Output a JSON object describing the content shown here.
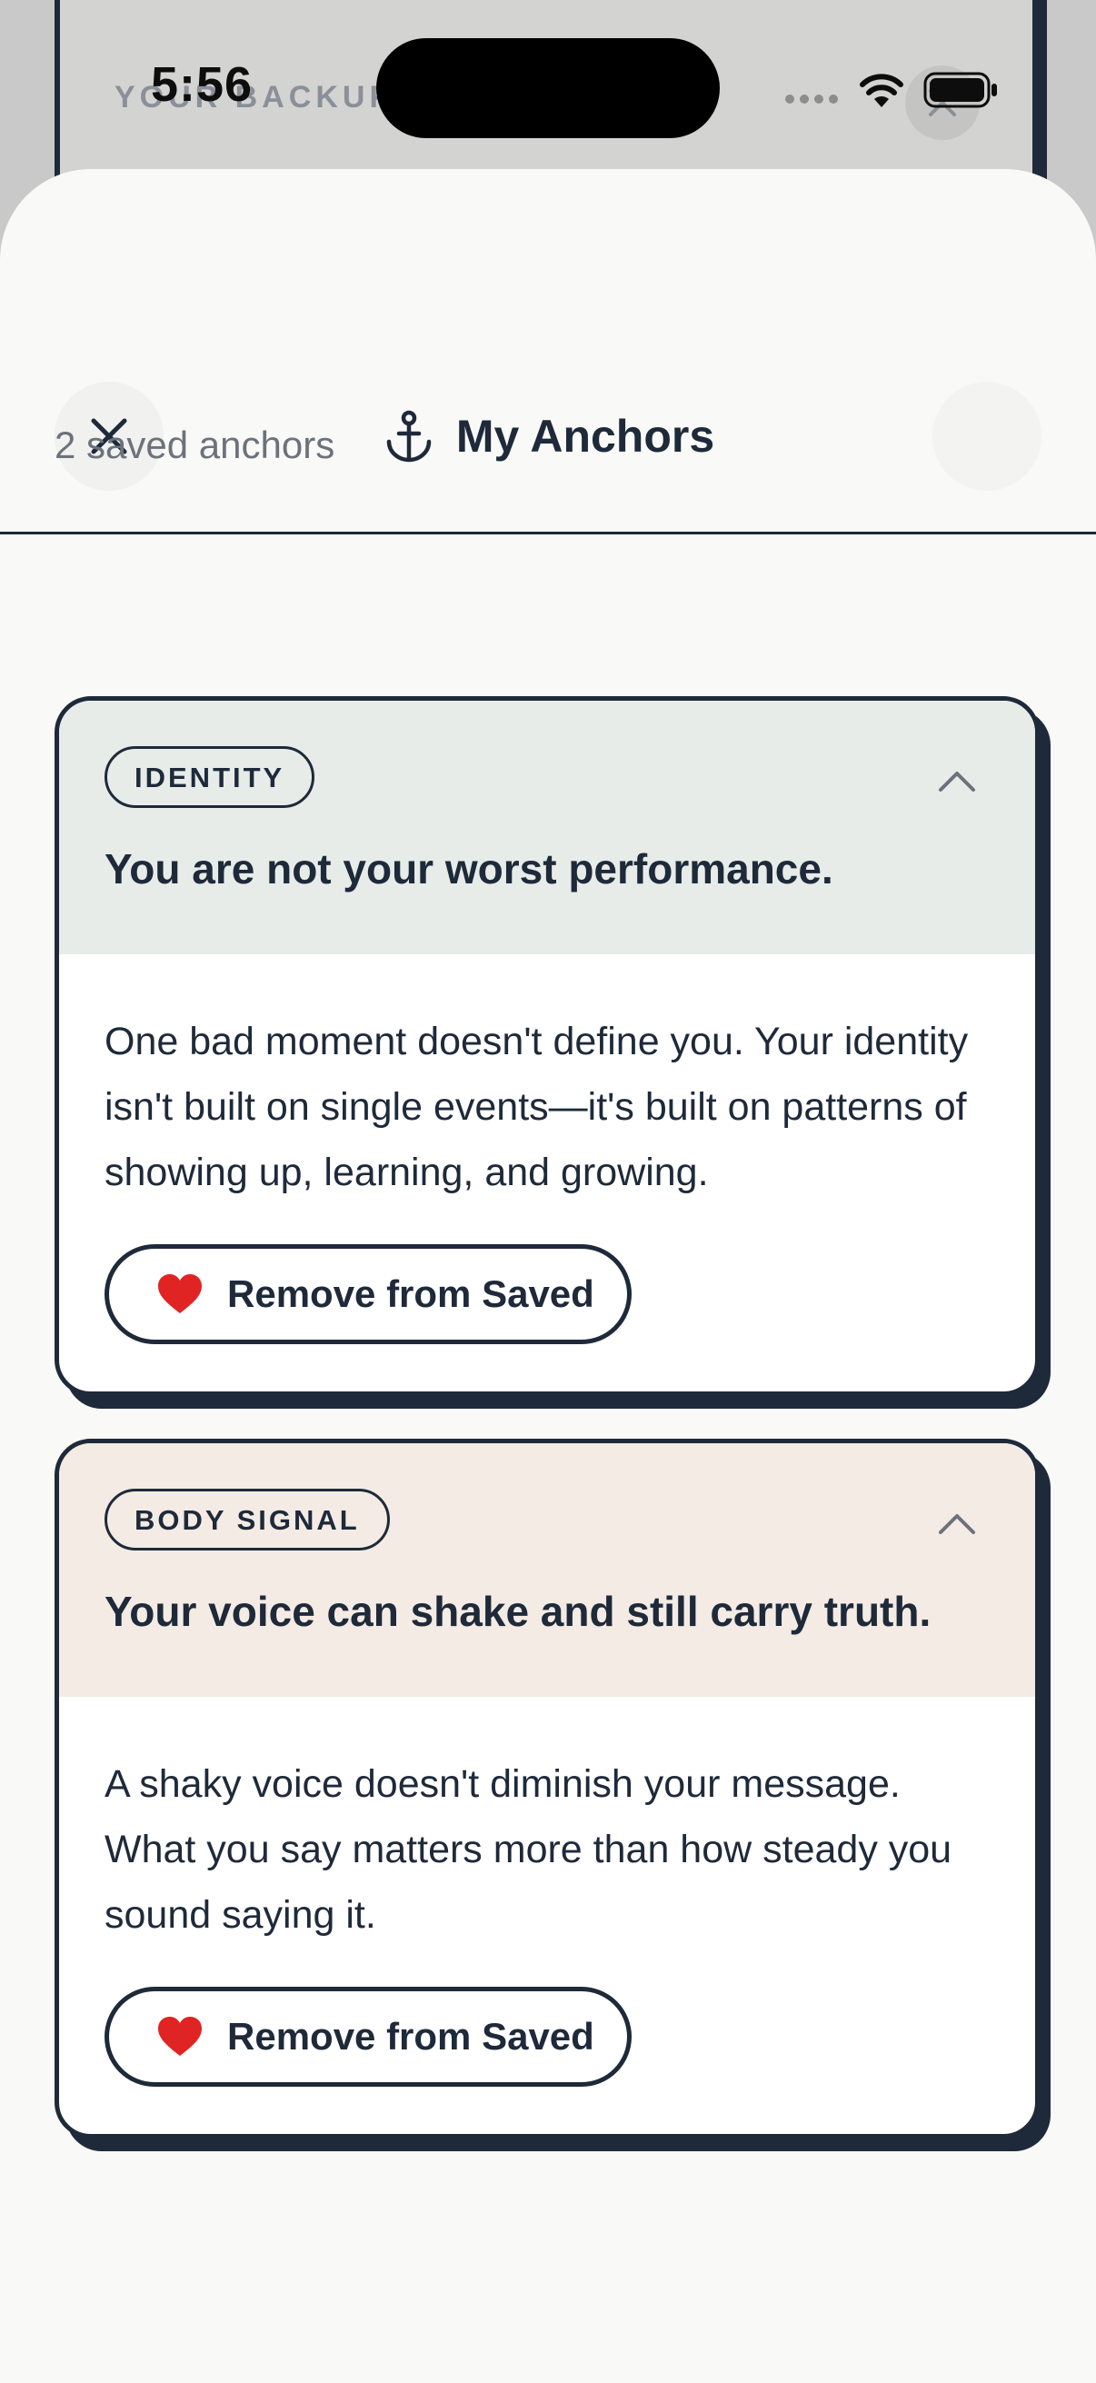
{
  "status_bar": {
    "time": "5:56"
  },
  "background_sheet": {
    "title": "YOUR BACKUP"
  },
  "header": {
    "title": "My Anchors",
    "title_icon": "anchor-icon",
    "close_icon": "close-icon"
  },
  "summary": {
    "count_text": "2 saved anchors"
  },
  "colors": {
    "ink": "#1e2a3a",
    "sheet_bg": "#f9f9f7",
    "identity_header_bg": "#e7ece9",
    "body_signal_header_bg": "#f4ebe4",
    "heart": "#e02424",
    "muted_text": "#6b727c"
  },
  "anchors": [
    {
      "tag": "IDENTITY",
      "title": "You are not your worst performance.",
      "body": "One bad moment doesn't define you. Your identity isn't built on single events—it's built on patterns of showing up, learning, and growing.",
      "action_label": "Remove from Saved",
      "expanded": true
    },
    {
      "tag": "BODY SIGNAL",
      "title": "Your voice can shake and still carry truth.",
      "body": "A shaky voice doesn't diminish your message. What you say matters more than how steady you sound saying it.",
      "action_label": "Remove from Saved",
      "expanded": true
    }
  ]
}
